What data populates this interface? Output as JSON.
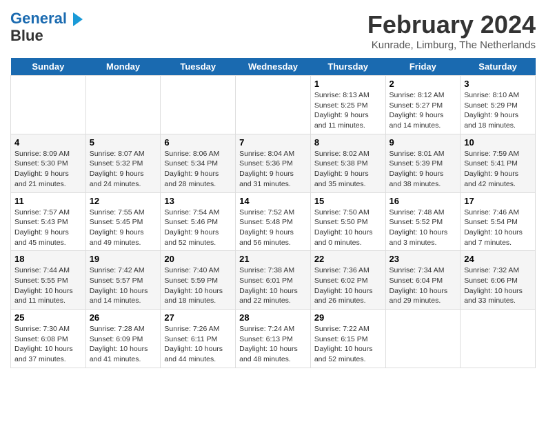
{
  "header": {
    "logo_line1": "General",
    "logo_line2": "Blue",
    "month_year": "February 2024",
    "location": "Kunrade, Limburg, The Netherlands"
  },
  "weekdays": [
    "Sunday",
    "Monday",
    "Tuesday",
    "Wednesday",
    "Thursday",
    "Friday",
    "Saturday"
  ],
  "weeks": [
    [
      {
        "day": "",
        "info": ""
      },
      {
        "day": "",
        "info": ""
      },
      {
        "day": "",
        "info": ""
      },
      {
        "day": "",
        "info": ""
      },
      {
        "day": "1",
        "info": "Sunrise: 8:13 AM\nSunset: 5:25 PM\nDaylight: 9 hours\nand 11 minutes."
      },
      {
        "day": "2",
        "info": "Sunrise: 8:12 AM\nSunset: 5:27 PM\nDaylight: 9 hours\nand 14 minutes."
      },
      {
        "day": "3",
        "info": "Sunrise: 8:10 AM\nSunset: 5:29 PM\nDaylight: 9 hours\nand 18 minutes."
      }
    ],
    [
      {
        "day": "4",
        "info": "Sunrise: 8:09 AM\nSunset: 5:30 PM\nDaylight: 9 hours\nand 21 minutes."
      },
      {
        "day": "5",
        "info": "Sunrise: 8:07 AM\nSunset: 5:32 PM\nDaylight: 9 hours\nand 24 minutes."
      },
      {
        "day": "6",
        "info": "Sunrise: 8:06 AM\nSunset: 5:34 PM\nDaylight: 9 hours\nand 28 minutes."
      },
      {
        "day": "7",
        "info": "Sunrise: 8:04 AM\nSunset: 5:36 PM\nDaylight: 9 hours\nand 31 minutes."
      },
      {
        "day": "8",
        "info": "Sunrise: 8:02 AM\nSunset: 5:38 PM\nDaylight: 9 hours\nand 35 minutes."
      },
      {
        "day": "9",
        "info": "Sunrise: 8:01 AM\nSunset: 5:39 PM\nDaylight: 9 hours\nand 38 minutes."
      },
      {
        "day": "10",
        "info": "Sunrise: 7:59 AM\nSunset: 5:41 PM\nDaylight: 9 hours\nand 42 minutes."
      }
    ],
    [
      {
        "day": "11",
        "info": "Sunrise: 7:57 AM\nSunset: 5:43 PM\nDaylight: 9 hours\nand 45 minutes."
      },
      {
        "day": "12",
        "info": "Sunrise: 7:55 AM\nSunset: 5:45 PM\nDaylight: 9 hours\nand 49 minutes."
      },
      {
        "day": "13",
        "info": "Sunrise: 7:54 AM\nSunset: 5:46 PM\nDaylight: 9 hours\nand 52 minutes."
      },
      {
        "day": "14",
        "info": "Sunrise: 7:52 AM\nSunset: 5:48 PM\nDaylight: 9 hours\nand 56 minutes."
      },
      {
        "day": "15",
        "info": "Sunrise: 7:50 AM\nSunset: 5:50 PM\nDaylight: 10 hours\nand 0 minutes."
      },
      {
        "day": "16",
        "info": "Sunrise: 7:48 AM\nSunset: 5:52 PM\nDaylight: 10 hours\nand 3 minutes."
      },
      {
        "day": "17",
        "info": "Sunrise: 7:46 AM\nSunset: 5:54 PM\nDaylight: 10 hours\nand 7 minutes."
      }
    ],
    [
      {
        "day": "18",
        "info": "Sunrise: 7:44 AM\nSunset: 5:55 PM\nDaylight: 10 hours\nand 11 minutes."
      },
      {
        "day": "19",
        "info": "Sunrise: 7:42 AM\nSunset: 5:57 PM\nDaylight: 10 hours\nand 14 minutes."
      },
      {
        "day": "20",
        "info": "Sunrise: 7:40 AM\nSunset: 5:59 PM\nDaylight: 10 hours\nand 18 minutes."
      },
      {
        "day": "21",
        "info": "Sunrise: 7:38 AM\nSunset: 6:01 PM\nDaylight: 10 hours\nand 22 minutes."
      },
      {
        "day": "22",
        "info": "Sunrise: 7:36 AM\nSunset: 6:02 PM\nDaylight: 10 hours\nand 26 minutes."
      },
      {
        "day": "23",
        "info": "Sunrise: 7:34 AM\nSunset: 6:04 PM\nDaylight: 10 hours\nand 29 minutes."
      },
      {
        "day": "24",
        "info": "Sunrise: 7:32 AM\nSunset: 6:06 PM\nDaylight: 10 hours\nand 33 minutes."
      }
    ],
    [
      {
        "day": "25",
        "info": "Sunrise: 7:30 AM\nSunset: 6:08 PM\nDaylight: 10 hours\nand 37 minutes."
      },
      {
        "day": "26",
        "info": "Sunrise: 7:28 AM\nSunset: 6:09 PM\nDaylight: 10 hours\nand 41 minutes."
      },
      {
        "day": "27",
        "info": "Sunrise: 7:26 AM\nSunset: 6:11 PM\nDaylight: 10 hours\nand 44 minutes."
      },
      {
        "day": "28",
        "info": "Sunrise: 7:24 AM\nSunset: 6:13 PM\nDaylight: 10 hours\nand 48 minutes."
      },
      {
        "day": "29",
        "info": "Sunrise: 7:22 AM\nSunset: 6:15 PM\nDaylight: 10 hours\nand 52 minutes."
      },
      {
        "day": "",
        "info": ""
      },
      {
        "day": "",
        "info": ""
      }
    ]
  ]
}
